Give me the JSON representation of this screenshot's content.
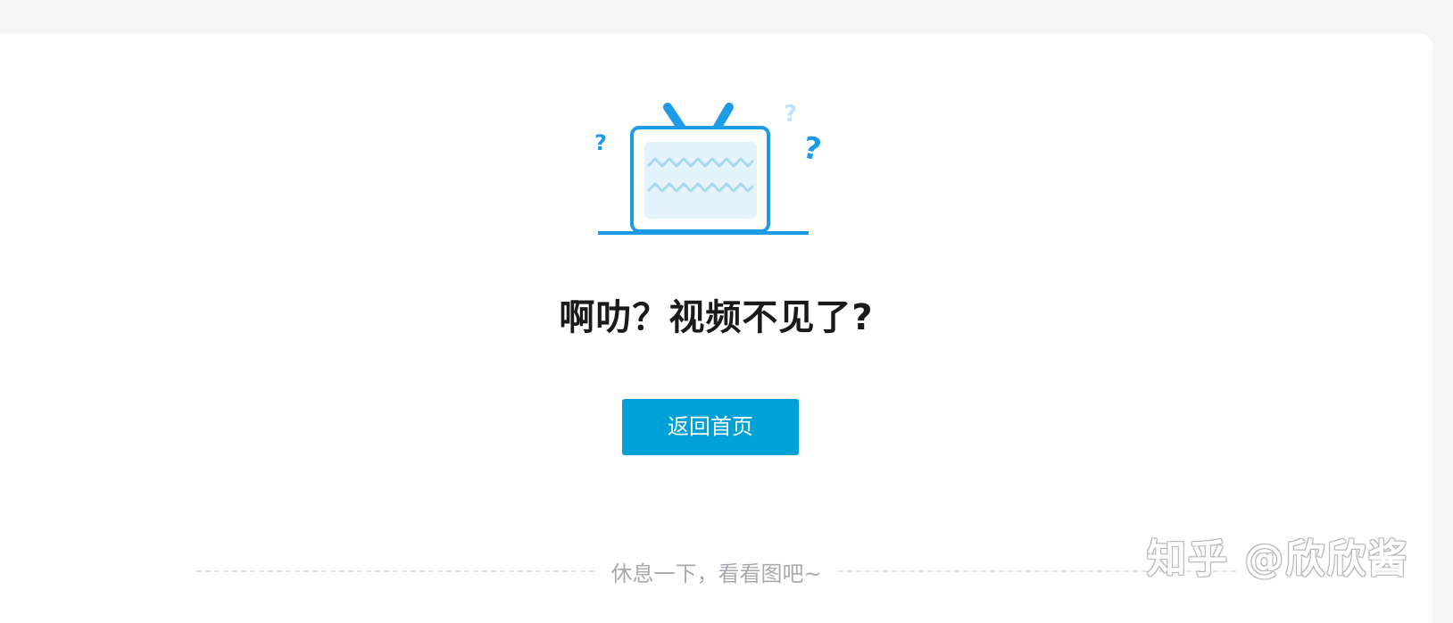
{
  "error": {
    "title": "啊叻？视频不见了?",
    "home_button_label": "返回首页",
    "divider_text": "休息一下，看看图吧~",
    "illustration_icon": "broken-tv-icon"
  },
  "watermark": {
    "text": "知乎 @欣欣酱"
  },
  "colors": {
    "accent": "#00a1d6",
    "illustration_blue": "#1e9be6",
    "illustration_light": "#e3f3fc",
    "page_bg": "#f4f5f7",
    "card_bg": "#ffffff",
    "title_text": "#1a1a1a",
    "muted_text": "#a7abb0"
  }
}
